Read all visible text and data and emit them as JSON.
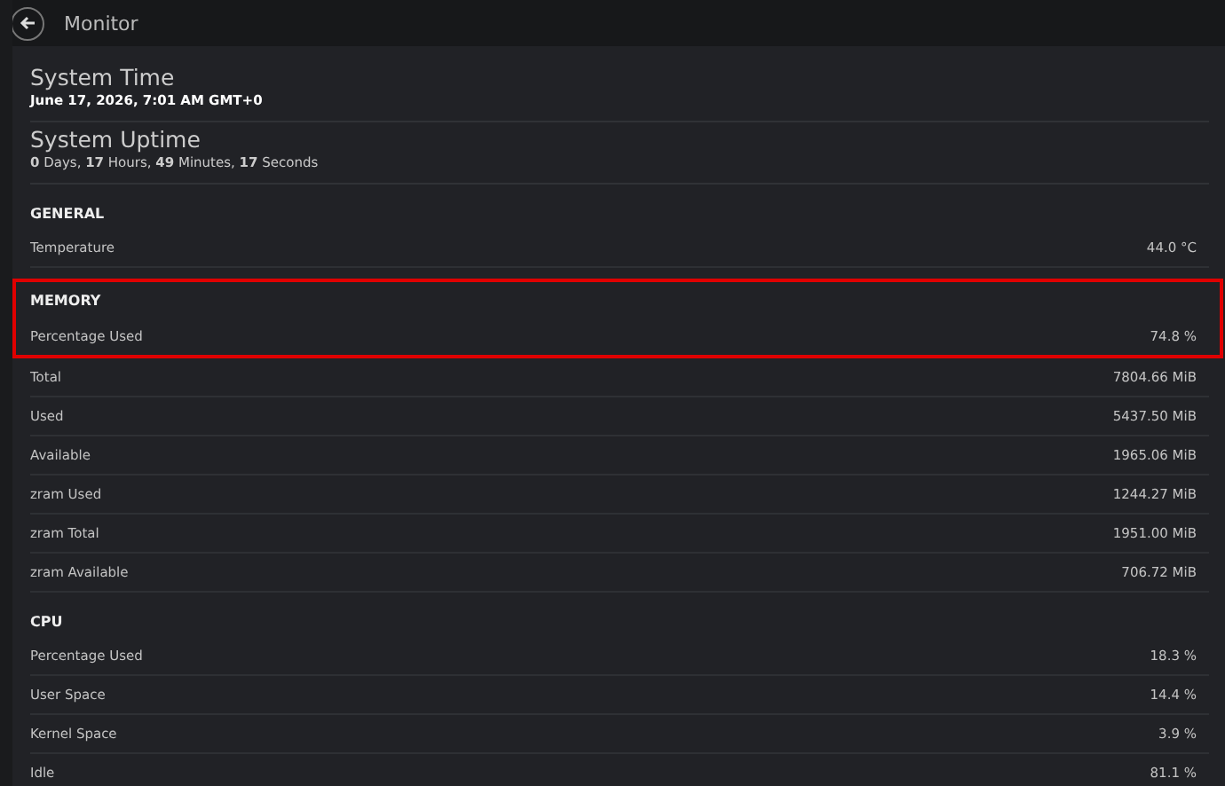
{
  "header": {
    "title": "Monitor"
  },
  "system_time": {
    "label": "System Time",
    "value": "June 17, 2026, 7:01 AM GMT+0"
  },
  "system_uptime": {
    "label": "System Uptime",
    "value": "**0** Days, **17** Hours, **49** Minutes, **17** Seconds"
  },
  "sections": [
    {
      "title": "GENERAL",
      "rows": [
        {
          "label": "Temperature",
          "value": "44.0 °C",
          "highlighted": false
        }
      ]
    },
    {
      "title": "MEMORY",
      "rows": [
        {
          "label": "Percentage Used",
          "value": "74.8 %",
          "highlighted": true
        },
        {
          "label": "Total",
          "value": "7804.66 MiB",
          "highlighted": false
        },
        {
          "label": "Used",
          "value": "5437.50 MiB",
          "highlighted": false
        },
        {
          "label": "Available",
          "value": "1965.06 MiB",
          "highlighted": false
        },
        {
          "label": "zram Used",
          "value": "1244.27 MiB",
          "highlighted": false
        },
        {
          "label": "zram Total",
          "value": "1951.00 MiB",
          "highlighted": false
        },
        {
          "label": "zram Available",
          "value": "706.72 MiB",
          "highlighted": false
        }
      ]
    },
    {
      "title": "CPU",
      "rows": [
        {
          "label": "Percentage Used",
          "value": "18.3 %",
          "highlighted": false
        },
        {
          "label": "User Space",
          "value": "14.4 %",
          "highlighted": false
        },
        {
          "label": "Kernel Space",
          "value": "3.9 %",
          "highlighted": false
        },
        {
          "label": "Idle",
          "value": "81.1 %",
          "highlighted": false
        }
      ]
    }
  ]
}
